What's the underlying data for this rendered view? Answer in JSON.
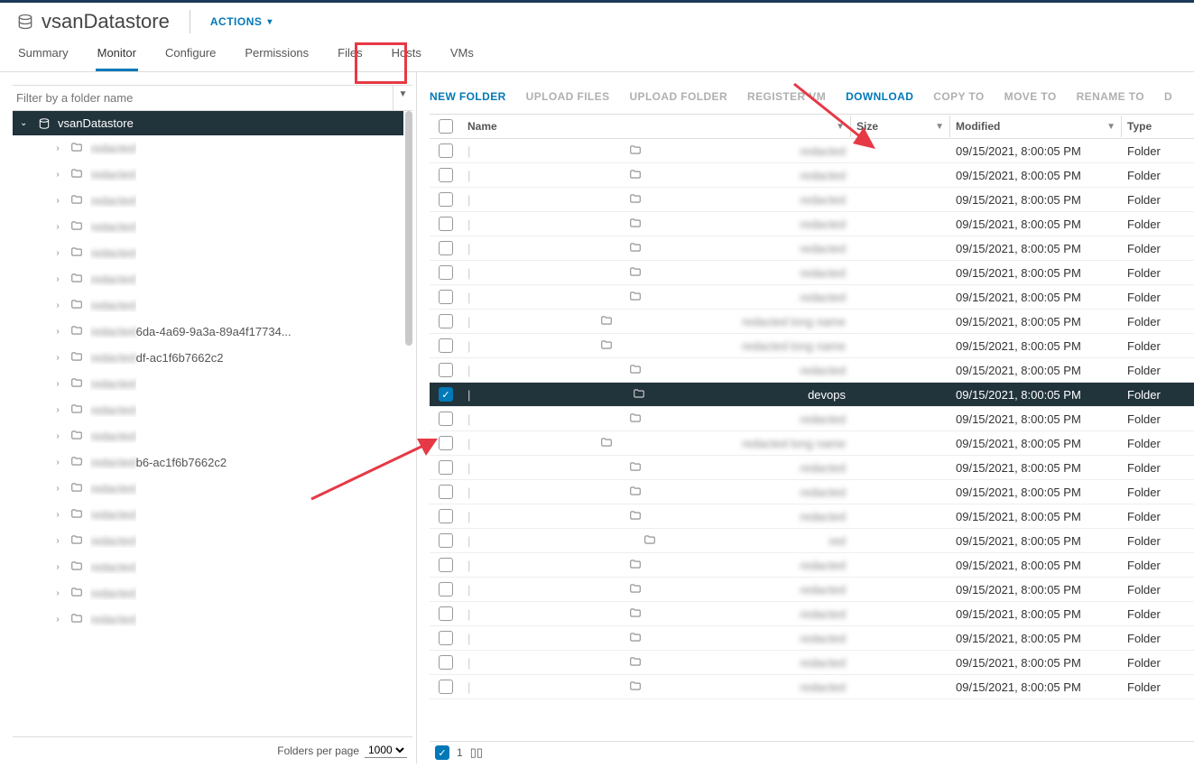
{
  "header": {
    "title": "vsanDatastore",
    "actions_label": "ACTIONS"
  },
  "tabs": {
    "items": [
      "Summary",
      "Monitor",
      "Configure",
      "Permissions",
      "Files",
      "Hosts",
      "VMs"
    ],
    "active_index": 1,
    "highlighted_index": 4
  },
  "left": {
    "filter_placeholder": "Filter by a folder name",
    "root_label": "vsanDatastore",
    "items": [
      {
        "name": "redacted",
        "visibleSuffix": ""
      },
      {
        "name": "redacted",
        "visibleSuffix": ""
      },
      {
        "name": "redacted",
        "visibleSuffix": ""
      },
      {
        "name": "redacted",
        "visibleSuffix": ""
      },
      {
        "name": "redacted",
        "visibleSuffix": ""
      },
      {
        "name": "redacted",
        "visibleSuffix": ""
      },
      {
        "name": "redacted",
        "visibleSuffix": ""
      },
      {
        "name": "redacted",
        "visibleSuffix": "6da-4a69-9a3a-89a4f17734..."
      },
      {
        "name": "redacted",
        "visibleSuffix": "df-ac1f6b7662c2"
      },
      {
        "name": "redacted",
        "visibleSuffix": ""
      },
      {
        "name": "redacted",
        "visibleSuffix": ""
      },
      {
        "name": "redacted",
        "visibleSuffix": ""
      },
      {
        "name": "redacted",
        "visibleSuffix": "b6-ac1f6b7662c2"
      },
      {
        "name": "redacted",
        "visibleSuffix": ""
      },
      {
        "name": "redacted",
        "visibleSuffix": ""
      },
      {
        "name": "redacted",
        "visibleSuffix": ""
      },
      {
        "name": "redacted",
        "visibleSuffix": ""
      },
      {
        "name": "redacted",
        "visibleSuffix": ""
      },
      {
        "name": "redacted",
        "visibleSuffix": ""
      }
    ],
    "pager_label": "Folders per page",
    "pager_value": "1000"
  },
  "toolbar": {
    "buttons": [
      {
        "label": "NEW FOLDER",
        "enabled": true
      },
      {
        "label": "UPLOAD FILES",
        "enabled": false
      },
      {
        "label": "UPLOAD FOLDER",
        "enabled": false
      },
      {
        "label": "REGISTER VM",
        "enabled": false
      },
      {
        "label": "DOWNLOAD",
        "enabled": true
      },
      {
        "label": "COPY TO",
        "enabled": false
      },
      {
        "label": "MOVE TO",
        "enabled": false
      },
      {
        "label": "RENAME TO",
        "enabled": false
      },
      {
        "label": "D",
        "enabled": false
      }
    ]
  },
  "grid": {
    "columns": {
      "name": "Name",
      "size": "Size",
      "modified": "Modified",
      "type": "Type"
    },
    "rows": [
      {
        "name": "redacted",
        "blur": true,
        "size": "",
        "modified": "09/15/2021, 8:00:05 PM",
        "type": "Folder",
        "selected": false
      },
      {
        "name": "redacted",
        "blur": true,
        "size": "",
        "modified": "09/15/2021, 8:00:05 PM",
        "type": "Folder",
        "selected": false
      },
      {
        "name": "redacted",
        "blur": true,
        "size": "",
        "modified": "09/15/2021, 8:00:05 PM",
        "type": "Folder",
        "selected": false
      },
      {
        "name": "redacted",
        "blur": true,
        "size": "",
        "modified": "09/15/2021, 8:00:05 PM",
        "type": "Folder",
        "selected": false
      },
      {
        "name": "redacted",
        "blur": true,
        "size": "",
        "modified": "09/15/2021, 8:00:05 PM",
        "type": "Folder",
        "selected": false
      },
      {
        "name": "redacted",
        "blur": true,
        "size": "",
        "modified": "09/15/2021, 8:00:05 PM",
        "type": "Folder",
        "selected": false
      },
      {
        "name": "redacted",
        "blur": true,
        "size": "",
        "modified": "09/15/2021, 8:00:05 PM",
        "type": "Folder",
        "selected": false
      },
      {
        "name": "redacted long name",
        "blur": true,
        "size": "",
        "modified": "09/15/2021, 8:00:05 PM",
        "type": "Folder",
        "selected": false
      },
      {
        "name": "redacted long name",
        "blur": true,
        "size": "",
        "modified": "09/15/2021, 8:00:05 PM",
        "type": "Folder",
        "selected": false
      },
      {
        "name": "redacted",
        "blur": true,
        "size": "",
        "modified": "09/15/2021, 8:00:05 PM",
        "type": "Folder",
        "selected": false
      },
      {
        "name": "devops",
        "blur": false,
        "size": "",
        "modified": "09/15/2021, 8:00:05 PM",
        "type": "Folder",
        "selected": true
      },
      {
        "name": "redacted",
        "blur": true,
        "size": "",
        "modified": "09/15/2021, 8:00:05 PM",
        "type": "Folder",
        "selected": false
      },
      {
        "name": "redacted long name",
        "blur": true,
        "size": "",
        "modified": "09/15/2021, 8:00:05 PM",
        "type": "Folder",
        "selected": false
      },
      {
        "name": "redacted",
        "blur": true,
        "size": "",
        "modified": "09/15/2021, 8:00:05 PM",
        "type": "Folder",
        "selected": false
      },
      {
        "name": "redacted",
        "blur": true,
        "size": "",
        "modified": "09/15/2021, 8:00:05 PM",
        "type": "Folder",
        "selected": false
      },
      {
        "name": "redacted",
        "blur": true,
        "size": "",
        "modified": "09/15/2021, 8:00:05 PM",
        "type": "Folder",
        "selected": false
      },
      {
        "name": "red",
        "blur": true,
        "size": "",
        "modified": "09/15/2021, 8:00:05 PM",
        "type": "Folder",
        "selected": false
      },
      {
        "name": "redacted",
        "blur": true,
        "size": "",
        "modified": "09/15/2021, 8:00:05 PM",
        "type": "Folder",
        "selected": false
      },
      {
        "name": "redacted",
        "blur": true,
        "size": "",
        "modified": "09/15/2021, 8:00:05 PM",
        "type": "Folder",
        "selected": false
      },
      {
        "name": "redacted",
        "blur": true,
        "size": "",
        "modified": "09/15/2021, 8:00:05 PM",
        "type": "Folder",
        "selected": false
      },
      {
        "name": "redacted",
        "blur": true,
        "size": "",
        "modified": "09/15/2021, 8:00:05 PM",
        "type": "Folder",
        "selected": false
      },
      {
        "name": "redacted",
        "blur": true,
        "size": "",
        "modified": "09/15/2021, 8:00:05 PM",
        "type": "Folder",
        "selected": false
      },
      {
        "name": "redacted",
        "blur": true,
        "size": "",
        "modified": "09/15/2021, 8:00:05 PM",
        "type": "Folder",
        "selected": false
      }
    ],
    "footer_count": "1"
  }
}
